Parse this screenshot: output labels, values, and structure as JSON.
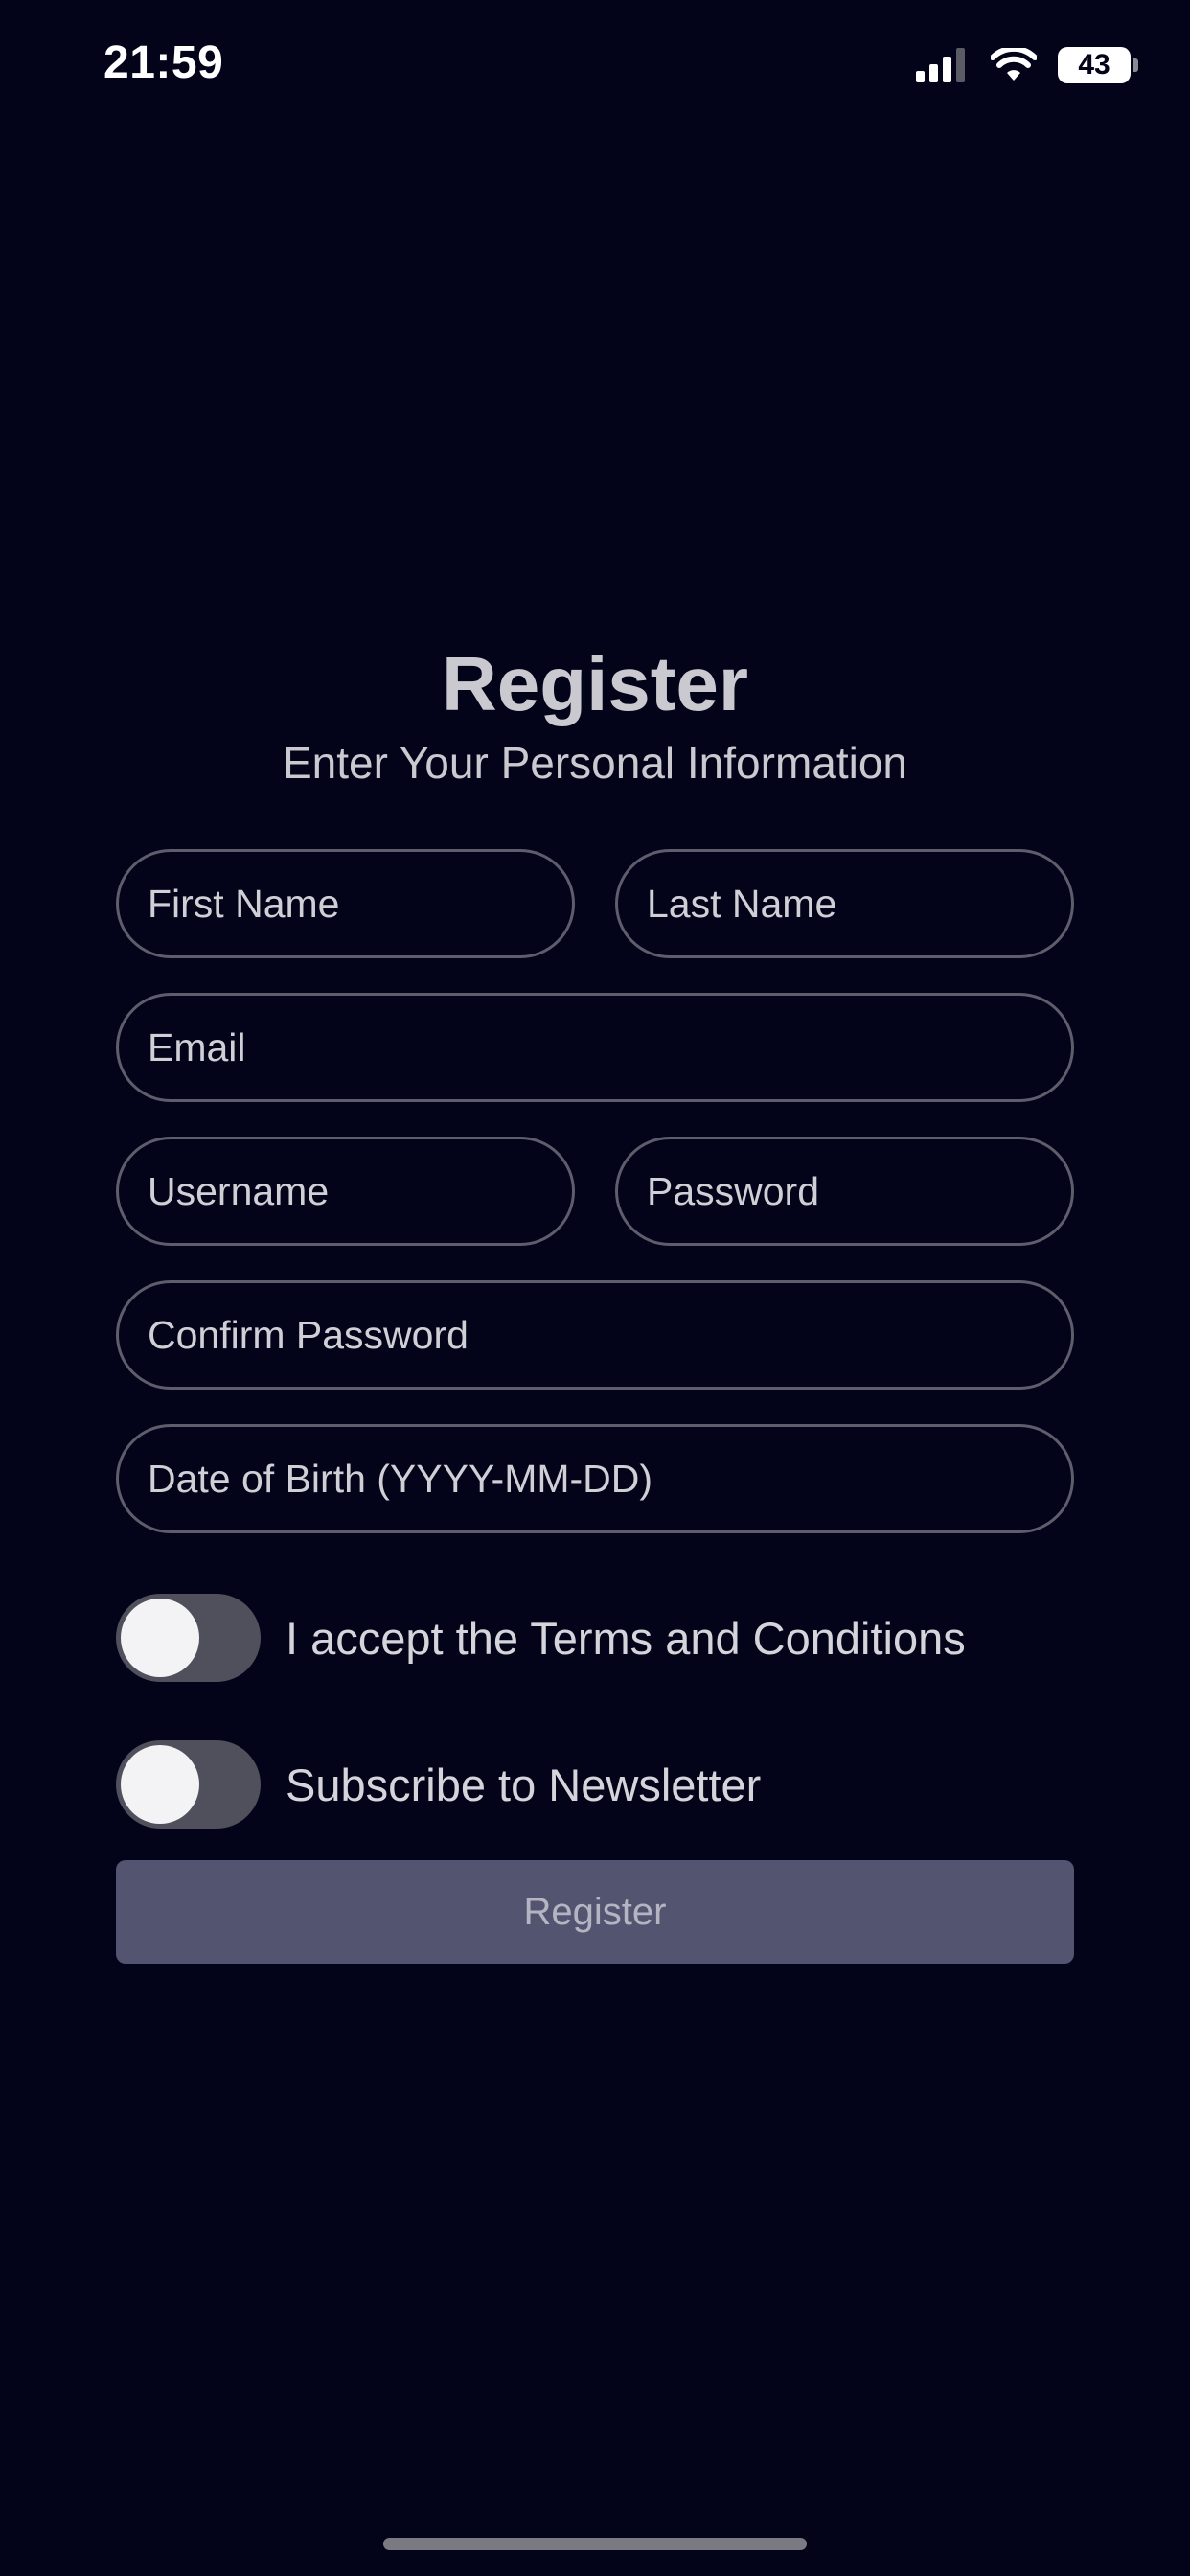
{
  "status_bar": {
    "time": "21:59",
    "battery": "43",
    "icons": [
      "signal-icon",
      "wifi-icon",
      "battery-icon"
    ]
  },
  "header": {
    "title": "Register",
    "subtitle": "Enter Your Personal Information"
  },
  "form": {
    "first_name_placeholder": "First Name",
    "last_name_placeholder": "Last Name",
    "email_placeholder": "Email",
    "username_placeholder": "Username",
    "password_placeholder": "Password",
    "confirm_password_placeholder": "Confirm Password",
    "dob_placeholder": "Date of Birth (YYYY-MM-DD)",
    "terms_label": "I accept the Terms and Conditions",
    "terms_checked": false,
    "newsletter_label": "Subscribe to Newsletter",
    "newsletter_checked": false,
    "submit_label": "Register"
  },
  "colors": {
    "background": "#03031a",
    "field_border": "#5d5d6b",
    "toggle_track": "#4f505c",
    "button_background": "#525470"
  }
}
